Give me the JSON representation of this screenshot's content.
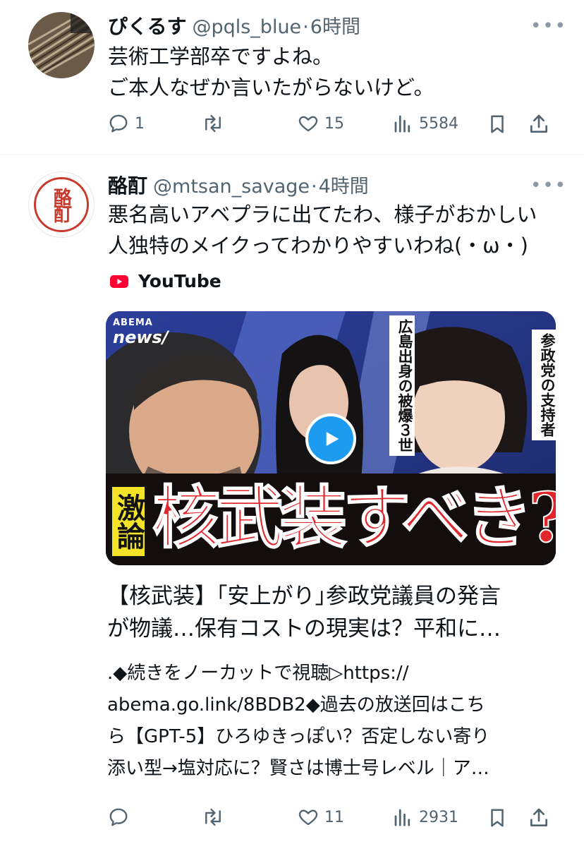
{
  "tweets": [
    {
      "name": "ぴくるす",
      "handle": "@pqls_blue",
      "sep": "·",
      "time": "6時間",
      "text": "芸術工学部卒ですよね。\nご本人なぜか言いたがらないけど。",
      "replies": "1",
      "retweets": "",
      "likes": "15",
      "views": "5584"
    },
    {
      "name": "酪酊",
      "handle": "@mtsan_savage",
      "sep": "·",
      "time": "4時間",
      "text": "悪名高いアベプラに出てたわ、様子がおかしい\n人独特のメイクってわかりやすいわね(・ω・)",
      "replies": "",
      "retweets": "",
      "likes": "11",
      "views": "2931",
      "avatar_text": "酪酊",
      "card": {
        "source": "YouTube",
        "thumb": {
          "logo_top": "ABEMA",
          "logo_bottom": "news/",
          "vertical_1": "広島出身の被爆３世",
          "vertical_2": "参政党の支持者",
          "badge": "激論",
          "headline": "核武装すべき?"
        },
        "title": "【核武装】｢安上がり｣参政党議員の発言\nが物議…保有コストの現実は？平和に…",
        "desc": ".◆続きをノーカットで視聴▷https://\nabema.go.link/8BDB2◆過去の放送回はこち\nら【GPT-5】ひろゆきっぽい？否定しない寄り\n添い型→塩対応に？賢さは博士号レベル｜ア…"
      }
    }
  ],
  "more_label": "•••",
  "colors": {
    "text": "#0f1419",
    "secondary": "#536471",
    "divider": "#eff3f4",
    "youtube": "#ff0033",
    "play": "#1d9bf0"
  }
}
